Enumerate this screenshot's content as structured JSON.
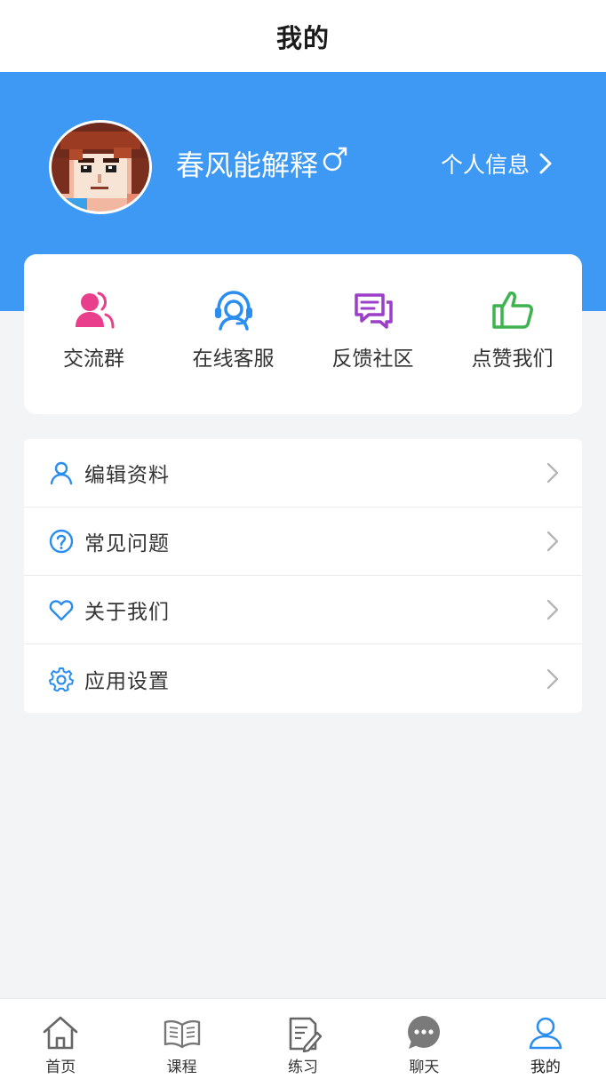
{
  "header": {
    "title": "我的"
  },
  "profile": {
    "username": "春风能解释",
    "gender_icon": "male-symbol-icon",
    "info_link": "个人信息"
  },
  "quick_actions": [
    {
      "label": "交流群",
      "icon": "group-chat-icon",
      "color": "#e83e8c"
    },
    {
      "label": "在线客服",
      "icon": "customer-service-icon",
      "color": "#2a8df0"
    },
    {
      "label": "反馈社区",
      "icon": "feedback-icon",
      "color": "#9b3fc9"
    },
    {
      "label": "点赞我们",
      "icon": "thumbs-up-icon",
      "color": "#3fb34f"
    }
  ],
  "menu": [
    {
      "label": "编辑资料",
      "icon": "user-icon"
    },
    {
      "label": "常见问题",
      "icon": "question-icon"
    },
    {
      "label": "关于我们",
      "icon": "heart-icon"
    },
    {
      "label": "应用设置",
      "icon": "gear-icon"
    }
  ],
  "tabbar": {
    "items": [
      {
        "label": "首页",
        "icon": "home-icon"
      },
      {
        "label": "课程",
        "icon": "book-icon"
      },
      {
        "label": "练习",
        "icon": "practice-icon"
      },
      {
        "label": "聊天",
        "icon": "chat-icon"
      },
      {
        "label": "我的",
        "icon": "profile-icon",
        "active": true
      }
    ]
  },
  "colors": {
    "accent": "#3e99f5",
    "background": "#f3f4f6",
    "menu_icon": "#2a8df0"
  }
}
